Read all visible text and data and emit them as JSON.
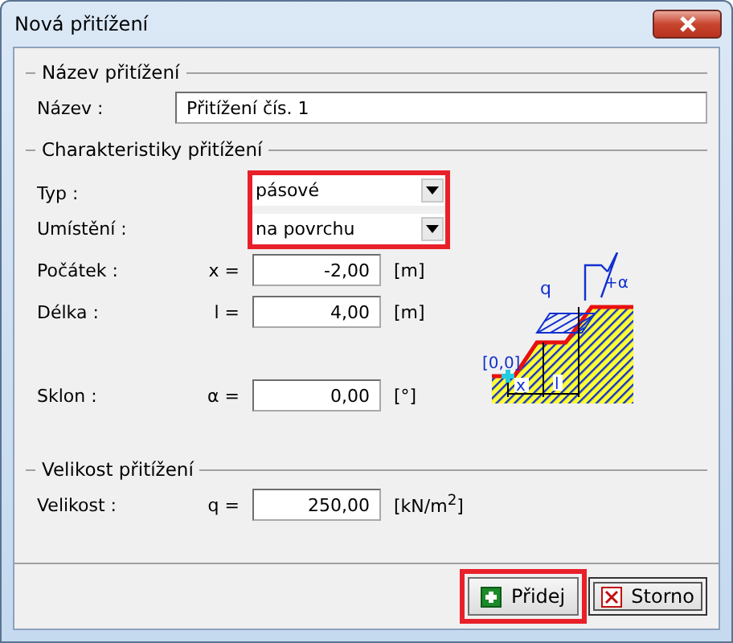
{
  "window": {
    "title": "Nová přitížení"
  },
  "name_group": {
    "title": "Název přitížení",
    "label": "Název :",
    "value": "Přitížení čís. 1"
  },
  "characteristics": {
    "title": "Charakteristiky přitížení",
    "selectors_highlighted": true,
    "selectors": [
      {
        "label": "Typ :",
        "value": "pásové"
      },
      {
        "label": "Umístění :",
        "value": "na povrchu"
      }
    ],
    "fields": [
      {
        "label": "Počátek :",
        "symbol": "x =",
        "value": "-2,00",
        "unit": "[m]"
      },
      {
        "label": "Délka :",
        "symbol": "l =",
        "value": "4,00",
        "unit": "[m]"
      },
      {
        "label": "Sklon :",
        "symbol": "α =",
        "value": "0,00",
        "unit": "[°]"
      }
    ],
    "diagram": {
      "q": "q",
      "angle": "+α",
      "origin": "[0,0]",
      "x": "x",
      "l": "l"
    }
  },
  "magnitude_group": {
    "title": "Velikost přitížení",
    "label": "Velikost :",
    "symbol": "q =",
    "value": "250,00",
    "unit": "[kN/m$^{2}$]"
  },
  "buttons": [
    {
      "label": "Přidej",
      "kind": "add",
      "highlighted": true,
      "focused": false
    },
    {
      "label": "Storno",
      "kind": "cancel",
      "highlighted": false,
      "focused": true
    }
  ]
}
